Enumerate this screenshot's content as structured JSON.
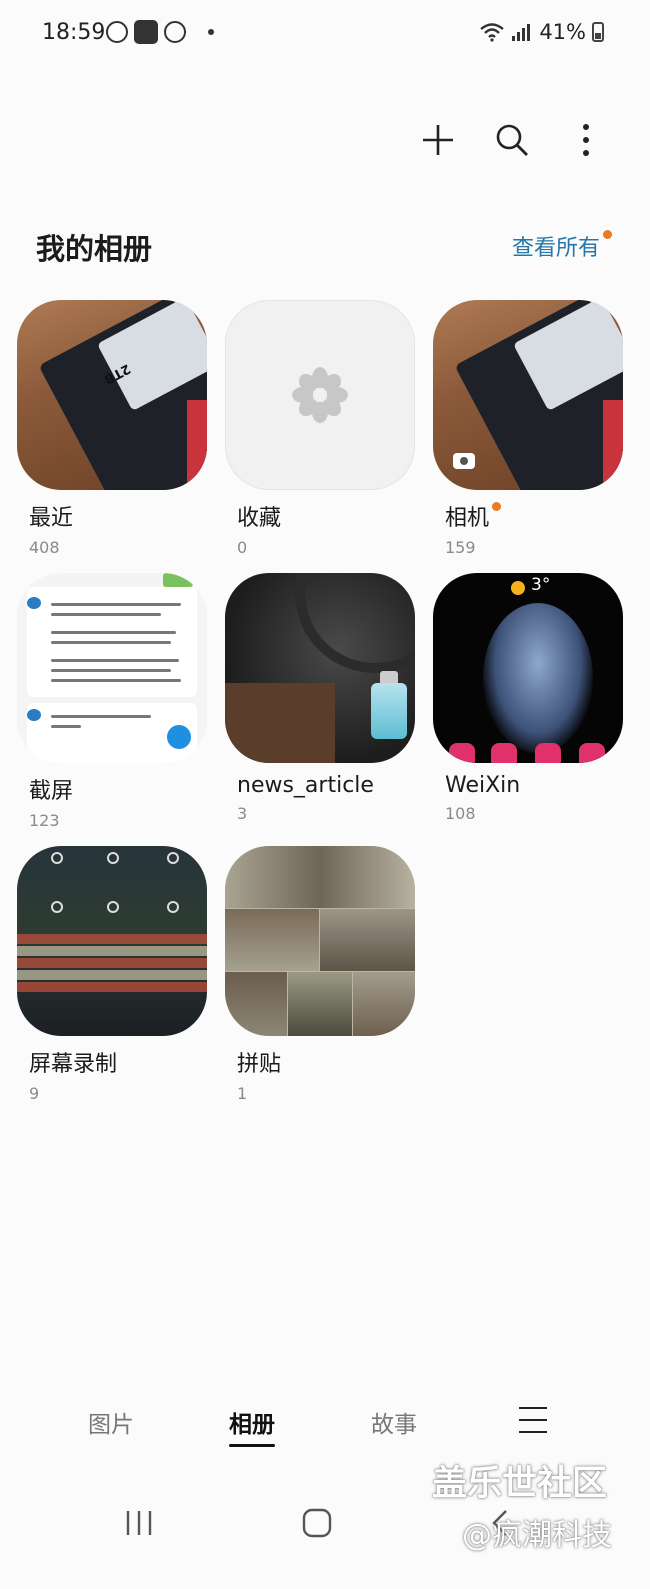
{
  "status": {
    "time": "18:59",
    "battery": "41%"
  },
  "header": {
    "title": "我的相册",
    "view_all": "查看所有"
  },
  "albums": [
    {
      "name": "最近",
      "count": "408"
    },
    {
      "name": "收藏",
      "count": "0"
    },
    {
      "name": "相机",
      "count": "159"
    },
    {
      "name": "截屏",
      "count": "123"
    },
    {
      "name": "news_article",
      "count": "3"
    },
    {
      "name": "WeiXin",
      "count": "108"
    },
    {
      "name": "屏幕录制",
      "count": "9"
    },
    {
      "name": "拼贴",
      "count": "1"
    }
  ],
  "thumb_text": {
    "weather_temp": "3°",
    "ssd_label": "2TB"
  },
  "bottom_tabs": [
    {
      "label": "图片"
    },
    {
      "label": "相册"
    },
    {
      "label": "故事"
    }
  ],
  "watermark": {
    "line1": "盖乐世社区",
    "line2": "@疯潮科技"
  },
  "colors": {
    "accent_link": "#2477a8",
    "notification_dot": "#ec7a1f"
  },
  "icons": {
    "toolbar": [
      "add-icon",
      "search-icon",
      "more-options-icon"
    ],
    "nav": [
      "recent-apps-icon",
      "home-icon",
      "back-icon"
    ]
  }
}
